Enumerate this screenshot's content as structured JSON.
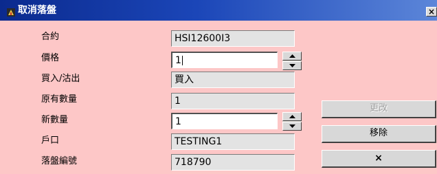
{
  "window": {
    "title": "取消落盤",
    "close_label": "×",
    "title_bar_colors": [
      "#0b2a8e",
      "#5c86d9"
    ],
    "background_color": "#fdc7c7"
  },
  "form": {
    "contract": {
      "label": "合約",
      "value": "HSI12600I3"
    },
    "price": {
      "label": "價格",
      "value": "1"
    },
    "side": {
      "label": "買入/沽出",
      "value": "買入"
    },
    "original_qty": {
      "label": "原有數量",
      "value": "1"
    },
    "new_qty": {
      "label": "新數量",
      "value": "1"
    },
    "account": {
      "label": "戶口",
      "value": "TESTING1"
    },
    "order_no": {
      "label": "落盤編號",
      "value": "718790"
    }
  },
  "buttons": {
    "modify": "更改",
    "remove": "移除",
    "cancel": "×"
  },
  "icons": {
    "app": "app-icon",
    "spin_up": "spin-up-icon",
    "spin_down": "spin-down-icon"
  }
}
